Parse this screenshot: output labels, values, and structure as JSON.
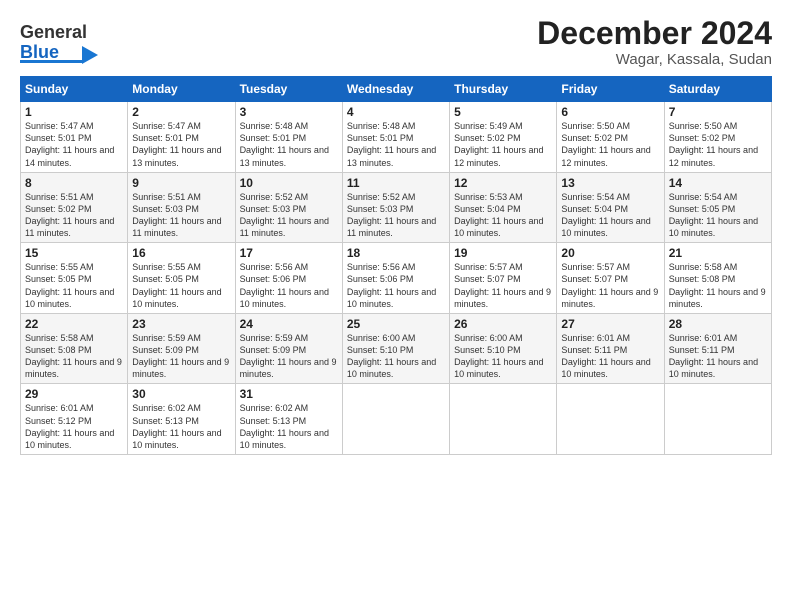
{
  "header": {
    "logo_line1": "General",
    "logo_line2": "Blue",
    "title": "December 2024",
    "subtitle": "Wagar, Kassala, Sudan"
  },
  "calendar": {
    "days_of_week": [
      "Sunday",
      "Monday",
      "Tuesday",
      "Wednesday",
      "Thursday",
      "Friday",
      "Saturday"
    ],
    "weeks": [
      [
        {
          "day": 1,
          "sunrise": "5:47 AM",
          "sunset": "5:01 PM",
          "daylight": "11 hours and 14 minutes."
        },
        {
          "day": 2,
          "sunrise": "5:47 AM",
          "sunset": "5:01 PM",
          "daylight": "11 hours and 13 minutes."
        },
        {
          "day": 3,
          "sunrise": "5:48 AM",
          "sunset": "5:01 PM",
          "daylight": "11 hours and 13 minutes."
        },
        {
          "day": 4,
          "sunrise": "5:48 AM",
          "sunset": "5:01 PM",
          "daylight": "11 hours and 13 minutes."
        },
        {
          "day": 5,
          "sunrise": "5:49 AM",
          "sunset": "5:02 PM",
          "daylight": "11 hours and 12 minutes."
        },
        {
          "day": 6,
          "sunrise": "5:50 AM",
          "sunset": "5:02 PM",
          "daylight": "11 hours and 12 minutes."
        },
        {
          "day": 7,
          "sunrise": "5:50 AM",
          "sunset": "5:02 PM",
          "daylight": "11 hours and 12 minutes."
        }
      ],
      [
        {
          "day": 8,
          "sunrise": "5:51 AM",
          "sunset": "5:02 PM",
          "daylight": "11 hours and 11 minutes."
        },
        {
          "day": 9,
          "sunrise": "5:51 AM",
          "sunset": "5:03 PM",
          "daylight": "11 hours and 11 minutes."
        },
        {
          "day": 10,
          "sunrise": "5:52 AM",
          "sunset": "5:03 PM",
          "daylight": "11 hours and 11 minutes."
        },
        {
          "day": 11,
          "sunrise": "5:52 AM",
          "sunset": "5:03 PM",
          "daylight": "11 hours and 11 minutes."
        },
        {
          "day": 12,
          "sunrise": "5:53 AM",
          "sunset": "5:04 PM",
          "daylight": "11 hours and 10 minutes."
        },
        {
          "day": 13,
          "sunrise": "5:54 AM",
          "sunset": "5:04 PM",
          "daylight": "11 hours and 10 minutes."
        },
        {
          "day": 14,
          "sunrise": "5:54 AM",
          "sunset": "5:05 PM",
          "daylight": "11 hours and 10 minutes."
        }
      ],
      [
        {
          "day": 15,
          "sunrise": "5:55 AM",
          "sunset": "5:05 PM",
          "daylight": "11 hours and 10 minutes."
        },
        {
          "day": 16,
          "sunrise": "5:55 AM",
          "sunset": "5:05 PM",
          "daylight": "11 hours and 10 minutes."
        },
        {
          "day": 17,
          "sunrise": "5:56 AM",
          "sunset": "5:06 PM",
          "daylight": "11 hours and 10 minutes."
        },
        {
          "day": 18,
          "sunrise": "5:56 AM",
          "sunset": "5:06 PM",
          "daylight": "11 hours and 10 minutes."
        },
        {
          "day": 19,
          "sunrise": "5:57 AM",
          "sunset": "5:07 PM",
          "daylight": "11 hours and 9 minutes."
        },
        {
          "day": 20,
          "sunrise": "5:57 AM",
          "sunset": "5:07 PM",
          "daylight": "11 hours and 9 minutes."
        },
        {
          "day": 21,
          "sunrise": "5:58 AM",
          "sunset": "5:08 PM",
          "daylight": "11 hours and 9 minutes."
        }
      ],
      [
        {
          "day": 22,
          "sunrise": "5:58 AM",
          "sunset": "5:08 PM",
          "daylight": "11 hours and 9 minutes."
        },
        {
          "day": 23,
          "sunrise": "5:59 AM",
          "sunset": "5:09 PM",
          "daylight": "11 hours and 9 minutes."
        },
        {
          "day": 24,
          "sunrise": "5:59 AM",
          "sunset": "5:09 PM",
          "daylight": "11 hours and 9 minutes."
        },
        {
          "day": 25,
          "sunrise": "6:00 AM",
          "sunset": "5:10 PM",
          "daylight": "11 hours and 10 minutes."
        },
        {
          "day": 26,
          "sunrise": "6:00 AM",
          "sunset": "5:10 PM",
          "daylight": "11 hours and 10 minutes."
        },
        {
          "day": 27,
          "sunrise": "6:01 AM",
          "sunset": "5:11 PM",
          "daylight": "11 hours and 10 minutes."
        },
        {
          "day": 28,
          "sunrise": "6:01 AM",
          "sunset": "5:11 PM",
          "daylight": "11 hours and 10 minutes."
        }
      ],
      [
        {
          "day": 29,
          "sunrise": "6:01 AM",
          "sunset": "5:12 PM",
          "daylight": "11 hours and 10 minutes."
        },
        {
          "day": 30,
          "sunrise": "6:02 AM",
          "sunset": "5:13 PM",
          "daylight": "11 hours and 10 minutes."
        },
        {
          "day": 31,
          "sunrise": "6:02 AM",
          "sunset": "5:13 PM",
          "daylight": "11 hours and 10 minutes."
        },
        null,
        null,
        null,
        null
      ]
    ]
  }
}
